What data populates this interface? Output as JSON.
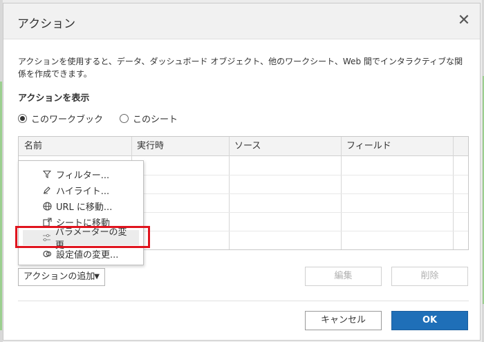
{
  "dialog": {
    "title": "アクション",
    "description": "アクションを使用すると、データ、ダッシュボード オブジェクト、他のワークシート、Web 間でインタラクティブな関係を作成できます。",
    "show_label": "アクションを表示",
    "radio": {
      "workbook": "このワークブック",
      "sheet": "このシート",
      "selected": "workbook"
    }
  },
  "table": {
    "columns": [
      "名前",
      "実行時",
      "ソース",
      "フィールド"
    ],
    "rows": []
  },
  "add_action": {
    "label": "アクションの追加",
    "menu": [
      {
        "label": "フィルター...",
        "icon": "filter-icon"
      },
      {
        "label": "ハイライト...",
        "icon": "highlighter-icon"
      },
      {
        "label": "URL に移動...",
        "icon": "globe-icon"
      },
      {
        "label": "シートに移動",
        "icon": "goto-sheet-icon"
      },
      {
        "label": "パラメーターの変更...",
        "icon": "sliders-icon"
      },
      {
        "label": "設定値の変更...",
        "icon": "set-values-icon"
      }
    ],
    "highlighted_index": 4
  },
  "buttons": {
    "edit": "編集",
    "delete": "削除",
    "cancel": "キャンセル",
    "ok": "OK"
  },
  "colors": {
    "ok_button": "#1f6fb8",
    "highlight_border": "#e0141e"
  }
}
